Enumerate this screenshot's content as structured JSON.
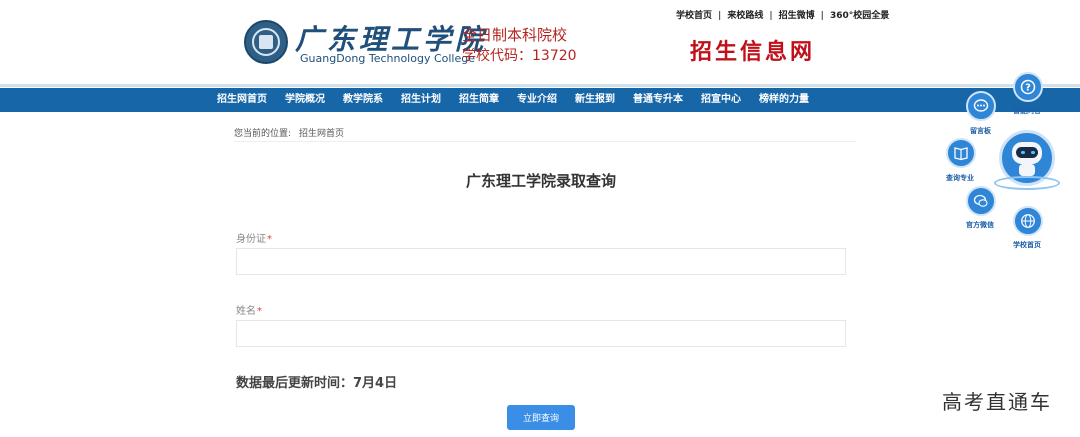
{
  "header": {
    "school_name": "广东理工学院",
    "school_name_en": "GuangDong Technology College",
    "college_type": "全日制本科院校",
    "college_code": "学校代码：13720",
    "site_title": "招生信息网",
    "top_links": [
      "学校首页",
      "来校路线",
      "招生微博",
      "360°校园全景"
    ]
  },
  "nav": {
    "items": [
      "招生网首页",
      "学院概况",
      "教学院系",
      "招生计划",
      "招生简章",
      "专业介绍",
      "新生报到",
      "普通专升本",
      "招宣中心",
      "榜样的力量"
    ]
  },
  "breadcrumb": {
    "prefix": "您当前的位置:",
    "current": "招生网首页"
  },
  "main": {
    "title": "广东理工学院录取查询",
    "id_label": "身份证",
    "name_label": "姓名",
    "required_mark": "*",
    "id_value": "",
    "name_value": "",
    "update_time": "数据最后更新时间：7月4日",
    "submit_label": "立即查询"
  },
  "floating": {
    "smart_qa": "智能问答",
    "message_board": "留言板",
    "query_major": "查询专业",
    "official_wechat": "官方微信",
    "school_home": "学校首页"
  },
  "watermark": "高考直通车",
  "colors": {
    "nav_bg": "#1766a8",
    "button": "#3a8ee6",
    "brand_red": "#c0101a",
    "brand_blue": "#1f4f7a"
  }
}
